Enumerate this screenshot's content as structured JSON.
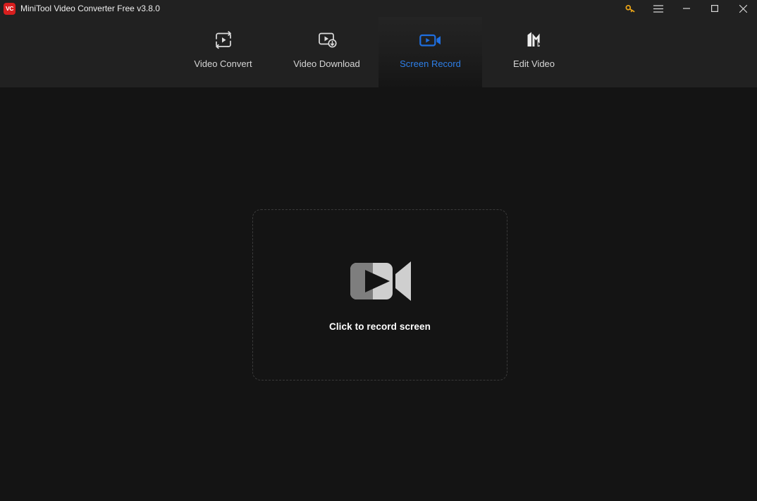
{
  "window": {
    "logo_text": "VC",
    "title": "MiniTool Video Converter Free v3.8.0",
    "controls": [
      {
        "name": "key-icon",
        "label": "Register"
      },
      {
        "name": "menu-icon",
        "label": "Menu"
      },
      {
        "name": "minimize-icon",
        "label": "Minimize"
      },
      {
        "name": "maximize-icon",
        "label": "Maximize"
      },
      {
        "name": "close-icon",
        "label": "Close"
      }
    ],
    "accent_color": "#2e7fe8",
    "key_color": "#e8a317",
    "logo_color": "#d81e1e",
    "titlebar_color": "#212121",
    "body_color": "#141414"
  },
  "nav": {
    "tabs": [
      {
        "label": "Video Convert",
        "icon": "video-convert-icon",
        "active": false
      },
      {
        "label": "Video Download",
        "icon": "video-download-icon",
        "active": false
      },
      {
        "label": "Screen Record",
        "icon": "screen-record-icon",
        "active": true
      },
      {
        "label": "Edit Video",
        "icon": "edit-video-icon",
        "active": false
      }
    ],
    "active_index": 2
  },
  "main": {
    "dropzone": {
      "icon": "camcorder-icon",
      "label": "Click to record screen"
    }
  }
}
